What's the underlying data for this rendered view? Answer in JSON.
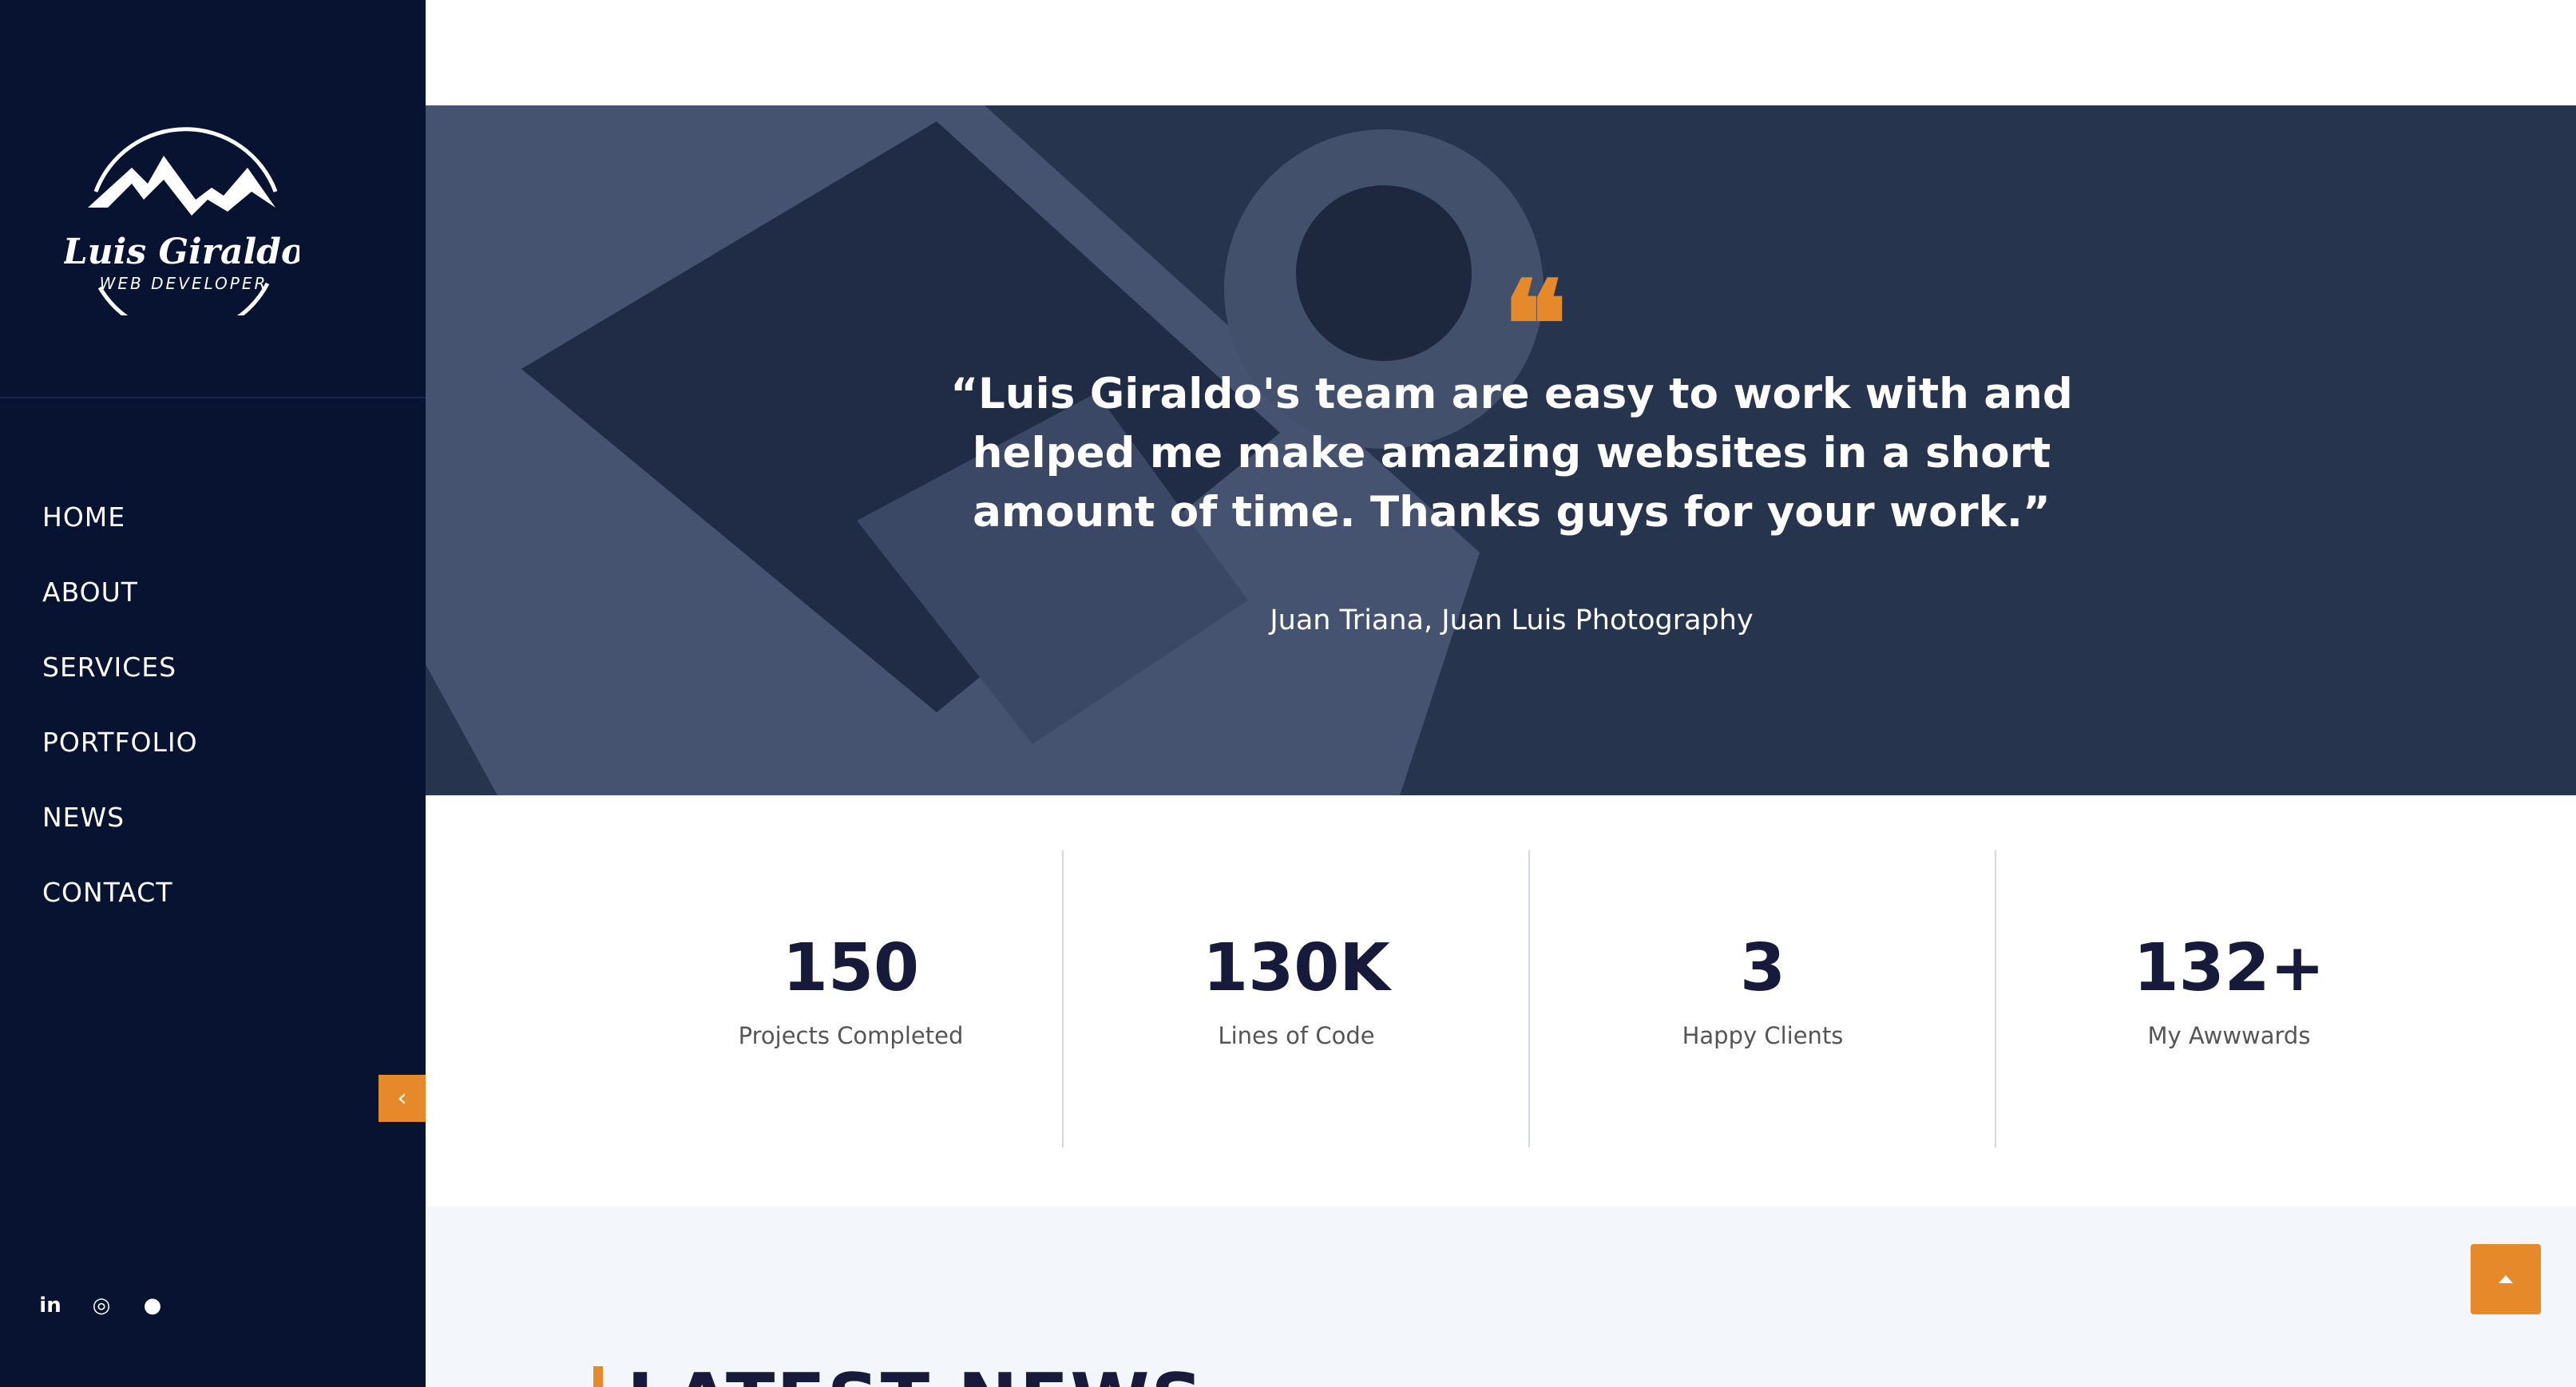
{
  "brand": {
    "logo_name": "Luis Giraldo",
    "logo_tagline": "WEB DEVELOPER"
  },
  "nav": {
    "items": [
      {
        "label": "HOME"
      },
      {
        "label": "ABOUT"
      },
      {
        "label": "SERVICES"
      },
      {
        "label": "PORTFOLIO"
      },
      {
        "label": "NEWS"
      },
      {
        "label": "CONTACT"
      }
    ],
    "collapse_glyph": "‹"
  },
  "socials": [
    {
      "icon": "linkedin-icon",
      "glyph": "in"
    },
    {
      "icon": "instagram-icon",
      "glyph": "◎"
    },
    {
      "icon": "github-icon",
      "glyph": "●"
    }
  ],
  "testimonial": {
    "quote_glyph": "❝",
    "quote": "“Luis Giraldo's team are easy to work with and helped me make amazing websites in a short amount of time. Thanks guys for your work.”",
    "author": "Juan Triana, Juan Luis Photography"
  },
  "stats": [
    {
      "value": "150",
      "label": "Projects Completed"
    },
    {
      "value": "130K",
      "label": "Lines of Code"
    },
    {
      "value": "3",
      "label": "Happy Clients"
    },
    {
      "value": "132+",
      "label": "My Awwwards"
    }
  ],
  "news": {
    "title": "LATEST NEWS"
  },
  "colors": {
    "sidebar": "#081332",
    "accent": "#e5892b",
    "heading": "#171a3a"
  }
}
